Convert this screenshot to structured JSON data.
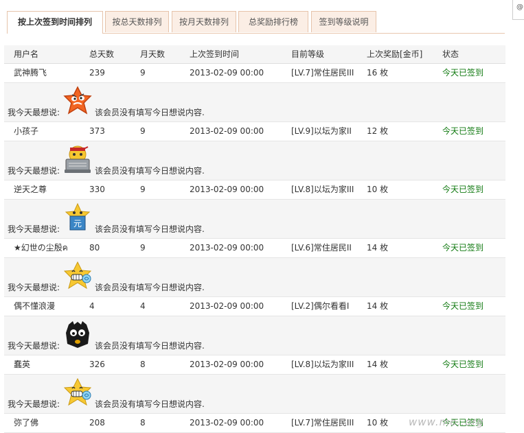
{
  "tabs": [
    {
      "label": "按上次签到时间排列",
      "active": true
    },
    {
      "label": "按总天数排列",
      "active": false
    },
    {
      "label": "按月天数排列",
      "active": false
    },
    {
      "label": "总奖励排行榜",
      "active": false
    },
    {
      "label": "签到等级说明",
      "active": false
    }
  ],
  "table": {
    "headers": [
      "用户名",
      "总天数",
      "月天数",
      "上次签到时间",
      "目前等级",
      "上次奖励[金币]",
      "状态"
    ],
    "message_label": "我今天最想说:",
    "default_message": "该会员没有填写今日想说内容.",
    "rows": [
      {
        "username": "武神腾飞",
        "total_days": "239",
        "month_days": "9",
        "last_signin": "2013-02-09 00:00",
        "level": "[LV.7]常住居民III",
        "reward": "16 枚",
        "status": "今天已签到",
        "mood_icon": "angry-star-icon"
      },
      {
        "username": "小孩子",
        "total_days": "373",
        "month_days": "9",
        "last_signin": "2013-02-09 00:00",
        "level": "[LV.9]以坛为家II",
        "reward": "12 枚",
        "status": "今天已签到",
        "mood_icon": "laptop-smiley-icon"
      },
      {
        "username": "逆天之尊",
        "total_days": "330",
        "month_days": "9",
        "last_signin": "2013-02-09 00:00",
        "level": "[LV.8]以坛为家III",
        "reward": "10 枚",
        "status": "今天已签到",
        "mood_icon": "money-star-icon"
      },
      {
        "username": "★幻世の尘殷ค",
        "total_days": "80",
        "month_days": "9",
        "last_signin": "2013-02-09 00:00",
        "level": "[LV.6]常住居民II",
        "reward": "14 枚",
        "status": "今天已签到",
        "mood_icon": "candy-star-icon"
      },
      {
        "username": "偶不懂浪漫",
        "total_days": "4",
        "month_days": "4",
        "last_signin": "2013-02-09 00:00",
        "level": "[LV.2]偶尔看看I",
        "reward": "14 枚",
        "status": "今天已签到",
        "mood_icon": "dark-face-icon"
      },
      {
        "username": "蠢英",
        "total_days": "326",
        "month_days": "8",
        "last_signin": "2013-02-09 00:00",
        "level": "[LV.8]以坛为家III",
        "reward": "14 枚",
        "status": "今天已签到",
        "mood_icon": "candy-star-icon"
      },
      {
        "username": "弥了佛",
        "total_days": "208",
        "month_days": "8",
        "last_signin": "2013-02-09 00:00",
        "level": "[LV.7]常住居民III",
        "reward": "10 枚",
        "status": "今天已签到"
      }
    ]
  },
  "watermark": "www.mo..org",
  "colors": {
    "status_green": "#117a11",
    "tab_border": "#e6c3aa",
    "tab_bg": "#fbeee5"
  }
}
